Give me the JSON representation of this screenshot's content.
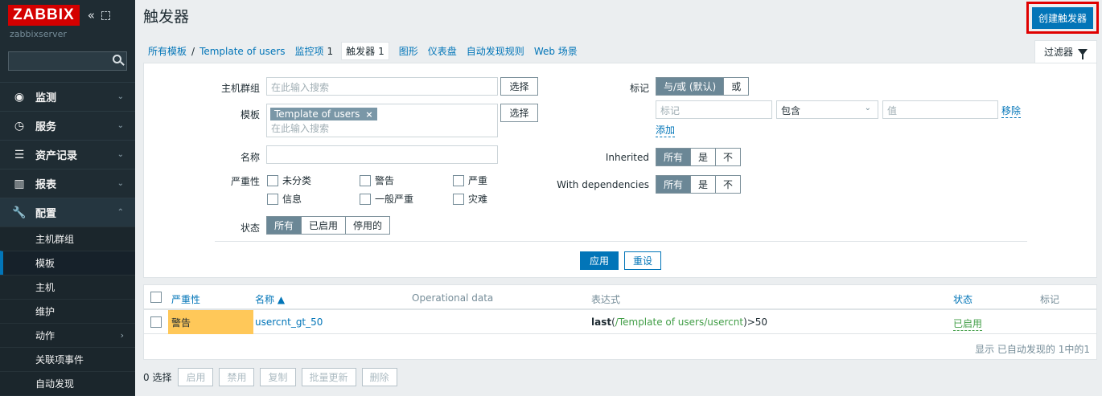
{
  "sidebar": {
    "logo": "ZABBIX",
    "server": "zabbixserver",
    "search_placeholder": "",
    "menu": [
      {
        "label": "监测",
        "icon": "eye-icon"
      },
      {
        "label": "服务",
        "icon": "clock-icon"
      },
      {
        "label": "资产记录",
        "icon": "list-icon"
      },
      {
        "label": "报表",
        "icon": "bar-chart-icon"
      },
      {
        "label": "配置",
        "icon": "wrench-icon"
      }
    ],
    "submenu": [
      "主机群组",
      "模板",
      "主机",
      "维护",
      "动作",
      "关联项事件",
      "自动发现"
    ]
  },
  "header": {
    "title": "触发器",
    "create_button": "创建触发器"
  },
  "breadcrumbs": {
    "all_templates": "所有模板",
    "separator": "/",
    "template": "Template of users",
    "items_label": "监控项",
    "items_count": "1",
    "triggers_label": "触发器",
    "triggers_count": "1",
    "graphs": "图形",
    "dashboards": "仪表盘",
    "discovery": "自动发现规则",
    "web": "Web 场景"
  },
  "filter": {
    "tab_label": "过滤器",
    "host_group_label": "主机群组",
    "host_group_placeholder": "在此输入搜索",
    "select_label": "选择",
    "template_label": "模板",
    "template_chip": "Template of users",
    "chip_remove": "×",
    "template_placeholder": "在此输入搜索",
    "name_label": "名称",
    "severity_label": "严重性",
    "severities": [
      "未分类",
      "警告",
      "严重",
      "信息",
      "一般严重",
      "灾难"
    ],
    "state_label": "状态",
    "state_options": [
      "所有",
      "已启用",
      "停用的"
    ],
    "tags_label": "标记",
    "tags_ops": [
      "与/或 (默认)",
      "或"
    ],
    "tag_placeholder": "标记",
    "tag_operator": "包含",
    "value_placeholder": "值",
    "remove_link": "移除",
    "add_link": "添加",
    "inherited_label": "Inherited",
    "deps_label": "With dependencies",
    "tri_options": [
      "所有",
      "是",
      "不"
    ],
    "apply": "应用",
    "reset": "重设"
  },
  "table": {
    "columns": {
      "severity": "严重性",
      "name": "名称 ▲",
      "opdata": "Operational data",
      "expression": "表达式",
      "status": "状态",
      "tags": "标记"
    },
    "rows": [
      {
        "severity": "警告",
        "name": "usercnt_gt_50",
        "expr_fn": "last",
        "expr_open": "(",
        "expr_host": "/Template of users/usercnt",
        "expr_close": ")>50",
        "status": "已启用",
        "severity_color": "#ffc859"
      }
    ],
    "footer": "显示 已自动发现的 1中的1"
  },
  "actions": {
    "selected": "0 选择",
    "buttons": [
      "启用",
      "禁用",
      "复制",
      "批量更新",
      "删除"
    ]
  }
}
